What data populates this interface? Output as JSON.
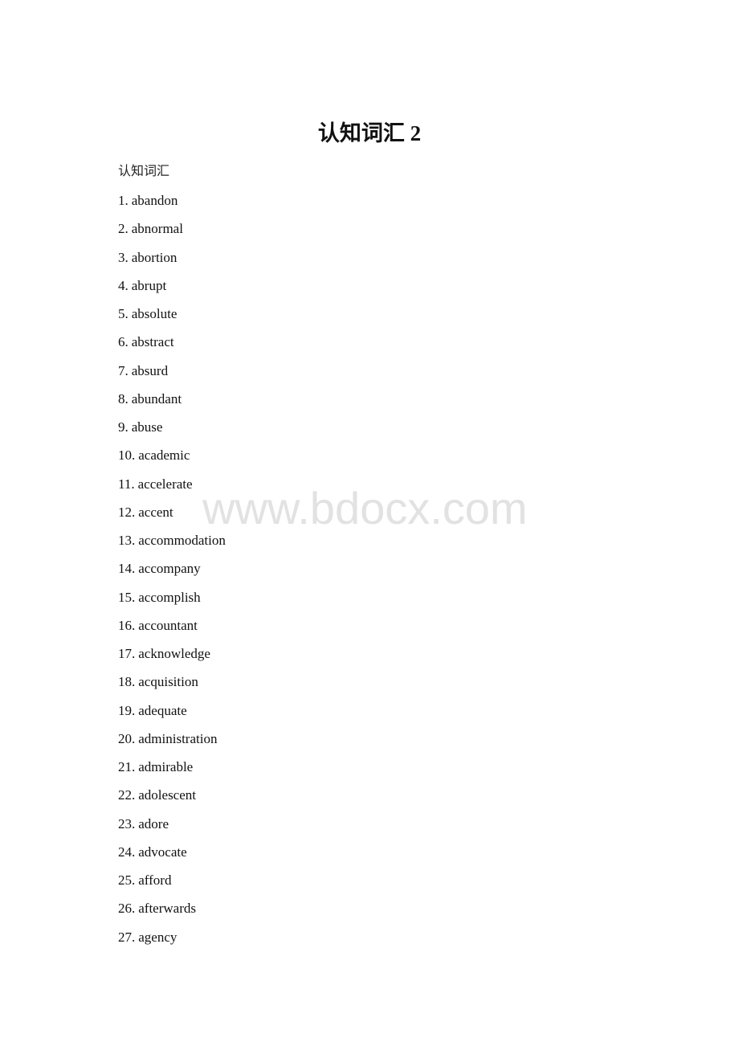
{
  "document": {
    "title": "认知词汇 2",
    "subtitle": "认知词汇",
    "watermark": "www.bdocx.com",
    "words": [
      {
        "num": "1.",
        "word": "abandon"
      },
      {
        "num": "2.",
        "word": "abnormal"
      },
      {
        "num": "3.",
        "word": "abortion"
      },
      {
        "num": "4.",
        "word": "abrupt"
      },
      {
        "num": "5.",
        "word": "absolute"
      },
      {
        "num": "6.",
        "word": "abstract"
      },
      {
        "num": "7.",
        "word": "absurd"
      },
      {
        "num": "8.",
        "word": "abundant"
      },
      {
        "num": "9.",
        "word": "abuse"
      },
      {
        "num": "10.",
        "word": "academic"
      },
      {
        "num": "11.",
        "word": "accelerate"
      },
      {
        "num": "12.",
        "word": "accent"
      },
      {
        "num": "13.",
        "word": "accommodation"
      },
      {
        "num": "14.",
        "word": "accompany"
      },
      {
        "num": "15.",
        "word": "accomplish"
      },
      {
        "num": "16.",
        "word": "accountant"
      },
      {
        "num": "17.",
        "word": "acknowledge"
      },
      {
        "num": "18.",
        "word": "acquisition"
      },
      {
        "num": "19.",
        "word": "adequate"
      },
      {
        "num": "20.",
        "word": "administration"
      },
      {
        "num": "21.",
        "word": "admirable"
      },
      {
        "num": "22.",
        "word": "adolescent"
      },
      {
        "num": "23.",
        "word": "adore"
      },
      {
        "num": "24.",
        "word": "advocate"
      },
      {
        "num": "25.",
        "word": "afford"
      },
      {
        "num": "26.",
        "word": "afterwards"
      },
      {
        "num": "27.",
        "word": "agency"
      }
    ]
  }
}
